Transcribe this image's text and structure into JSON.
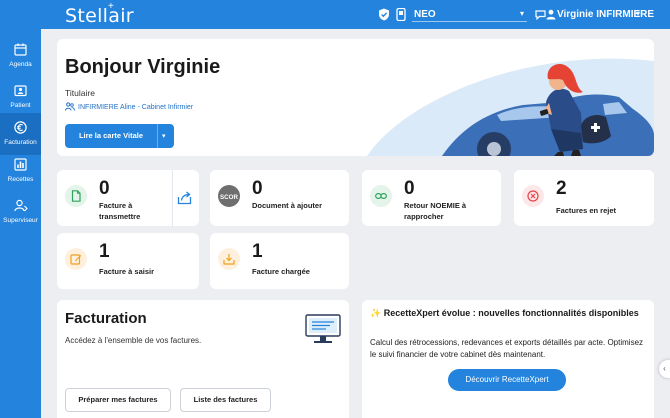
{
  "app": {
    "logo": "Stellair",
    "logo_mark": "+"
  },
  "topbar": {
    "site": "NEO",
    "user": "Virginie INFIRMIERE",
    "caret": "▾"
  },
  "nav": [
    {
      "id": "agenda",
      "label": "Agenda",
      "icon": "calendar-icon"
    },
    {
      "id": "patient",
      "label": "Patient",
      "icon": "patient-folder-icon"
    },
    {
      "id": "facturation",
      "label": "Facturation",
      "icon": "euro-icon",
      "active": true
    },
    {
      "id": "recettes",
      "label": "Recettes",
      "icon": "bar-chart-icon"
    },
    {
      "id": "superviseur",
      "label": "Superviseur",
      "icon": "supervisor-icon"
    }
  ],
  "greeting": {
    "title": "Bonjour Virginie",
    "role": "Titulaire",
    "cabinet": "INFIRMIERE Aline - Cabinet Infirmier",
    "vitale_button": "Lire la carte Vitale"
  },
  "stats": [
    {
      "id": "a-transmettre",
      "value": "0",
      "label": [
        "Facture à",
        "transmettre"
      ]
    },
    {
      "id": "document",
      "value": "0",
      "label": [
        "Document à ajouter"
      ],
      "badge": "SCOR"
    },
    {
      "id": "noemie",
      "value": "0",
      "label": [
        "Retour NOEMIE à",
        "rapprocher"
      ]
    },
    {
      "id": "rejet",
      "value": "2",
      "label": [
        "Factures en rejet"
      ]
    },
    {
      "id": "a-saisir",
      "value": "1",
      "label": [
        "Facture à saisir"
      ]
    },
    {
      "id": "chargee",
      "value": "1",
      "label": [
        "Facture chargée"
      ]
    }
  ],
  "facturation": {
    "title": "Facturation",
    "subtitle": "Accédez à l'ensemble de vos factures.",
    "btn_prepare": "Préparer mes factures",
    "btn_list": "Liste des factures"
  },
  "recette": {
    "icon": "✨",
    "title": "RecetteXpert évolue : nouvelles fonctionnalités disponibles",
    "desc": "Calcul des rétrocessions, redevances et exports détaillés par acte. Optimisez le suivi financier de votre cabinet dès maintenant.",
    "button": "Découvrir RecetteXpert"
  },
  "edge_toggle": "‹",
  "colors": {
    "brand": "#2383dd",
    "brand_dark": "#1a6fc2",
    "green": "#2fa35b",
    "red": "#e0474c",
    "orange": "#f0a020"
  }
}
